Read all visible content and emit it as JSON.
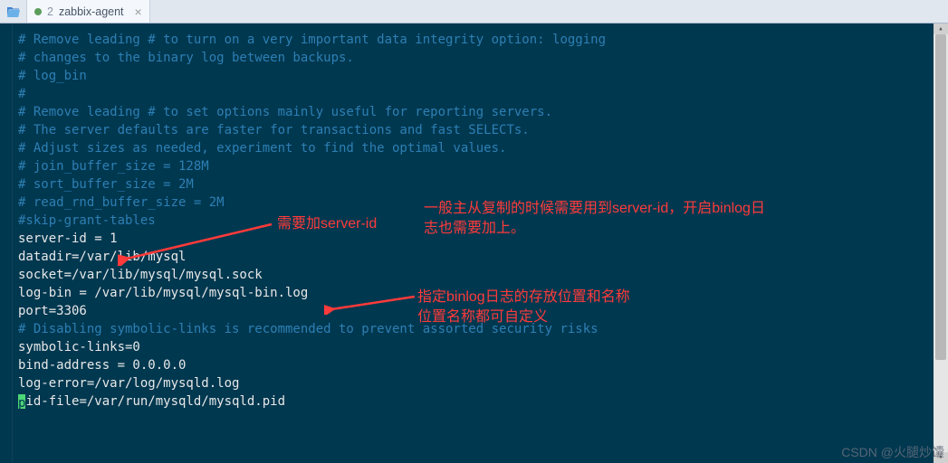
{
  "tabbar": {
    "folder_icon": "folder-open",
    "tab": {
      "num": "2",
      "name": "zabbix-agent",
      "modified": true
    }
  },
  "editor": {
    "lines": [
      {
        "cls": "comment",
        "text": "# Remove leading # to turn on a very important data integrity option: logging"
      },
      {
        "cls": "comment",
        "text": "# changes to the binary log between backups."
      },
      {
        "cls": "comment",
        "text": "# log_bin"
      },
      {
        "cls": "comment",
        "text": "#"
      },
      {
        "cls": "comment",
        "text": "# Remove leading # to set options mainly useful for reporting servers."
      },
      {
        "cls": "comment",
        "text": "# The server defaults are faster for transactions and fast SELECTs."
      },
      {
        "cls": "comment",
        "text": "# Adjust sizes as needed, experiment to find the optimal values."
      },
      {
        "cls": "comment",
        "text": "# join_buffer_size = 128M"
      },
      {
        "cls": "comment",
        "text": "# sort_buffer_size = 2M"
      },
      {
        "cls": "comment",
        "text": "# read_rnd_buffer_size = 2M"
      },
      {
        "cls": "comment",
        "text": "#skip-grant-tables"
      },
      {
        "cls": "plain",
        "text": "server-id = 1"
      },
      {
        "cls": "plain",
        "text": "datadir=/var/lib/mysql"
      },
      {
        "cls": "plain",
        "text": "socket=/var/lib/mysql/mysql.sock"
      },
      {
        "cls": "plain",
        "text": "log-bin = /var/lib/mysql/mysql-bin.log"
      },
      {
        "cls": "plain",
        "text": "port=3306"
      },
      {
        "cls": "comment",
        "text": "# Disabling symbolic-links is recommended to prevent assorted security risks"
      },
      {
        "cls": "plain",
        "text": "symbolic-links=0"
      },
      {
        "cls": "plain",
        "text": ""
      },
      {
        "cls": "plain",
        "text": "bind-address = 0.0.0.0"
      },
      {
        "cls": "plain",
        "text": "log-error=/var/log/mysqld.log"
      },
      {
        "cls": "plain",
        "text": "pid-file=/var/run/mysqld/mysqld.pid"
      }
    ]
  },
  "annotations": {
    "a1": "需要加server-id",
    "a2_l1": "一般主从复制的时候需要用到server-id，开启binlog日",
    "a2_l2": "志也需要加上。",
    "a3_l1": "指定binlog日志的存放位置和名称",
    "a3_l2": "位置名称都可自定义"
  },
  "watermark": "CSDN @火腿炒馕"
}
